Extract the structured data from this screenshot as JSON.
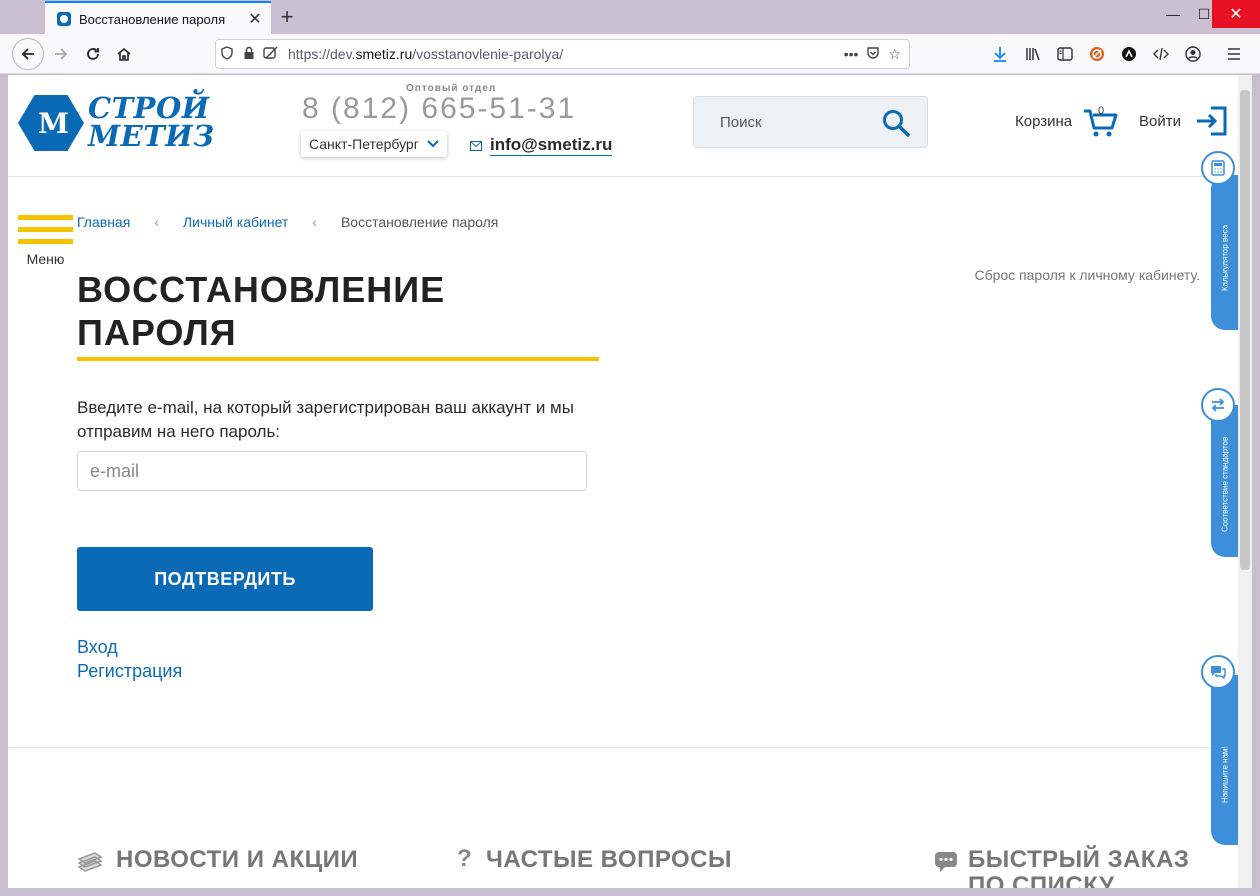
{
  "browser": {
    "tab_title": "Восстановление пароля",
    "url_prefix": "https://dev.",
    "url_domain": "smetiz.ru",
    "url_path": "/vosstanovlenie-parolya/",
    "tab_close": "✕",
    "new_tab": "+",
    "window_min": "—",
    "window_max": "☐",
    "window_close": "✕"
  },
  "header": {
    "logo_line1": "СТРОЙ",
    "logo_line2": "МЕТИЗ",
    "logo_mark": "M",
    "dept_label": "Оптовый отдел",
    "phone": "8 (812) 665-51-31",
    "city": "Санкт-Петербург",
    "email": "info@smetiz.ru",
    "search_placeholder": "Поиск",
    "cart_label": "Корзина",
    "cart_count": "0",
    "login_label": "Войти"
  },
  "menu": {
    "label": "Меню"
  },
  "breadcrumbs": [
    {
      "label": "Главная"
    },
    {
      "label": "Личный кабинет"
    },
    {
      "label": "Восстановление пароля"
    }
  ],
  "main": {
    "title_line1": "ВОССТАНОВЛЕНИЕ",
    "title_line2": "ПАРОЛЯ",
    "note": "Сброс пароля к личному кабинету.",
    "intro": "Введите e-mail, на который зарегистрирован ваш аккаунт и мы отправим на него пароль:",
    "email_placeholder": "e-mail",
    "submit_label": "ПОДТВЕРДИТЬ",
    "link_login": "Вход",
    "link_register": "Регистрация"
  },
  "footer": {
    "news": "НОВОСТИ И АКЦИИ",
    "faq": "ЧАСТЫЕ ВОПРОСЫ",
    "quick_order": "БЫСТРЫЙ ЗАКАЗ ПО СПИСКУ"
  },
  "side_tabs": [
    {
      "label": "Калькулятор веса",
      "icon": "calculator-icon"
    },
    {
      "label": "Соответствие стандартов",
      "icon": "arrows-swap-icon"
    },
    {
      "label": "Напишите нам!",
      "icon": "chat-icon"
    }
  ],
  "colors": {
    "brand_blue": "#0a6ab6",
    "accent_yellow": "#f5c400",
    "side_blue": "#3d8fd9"
  }
}
